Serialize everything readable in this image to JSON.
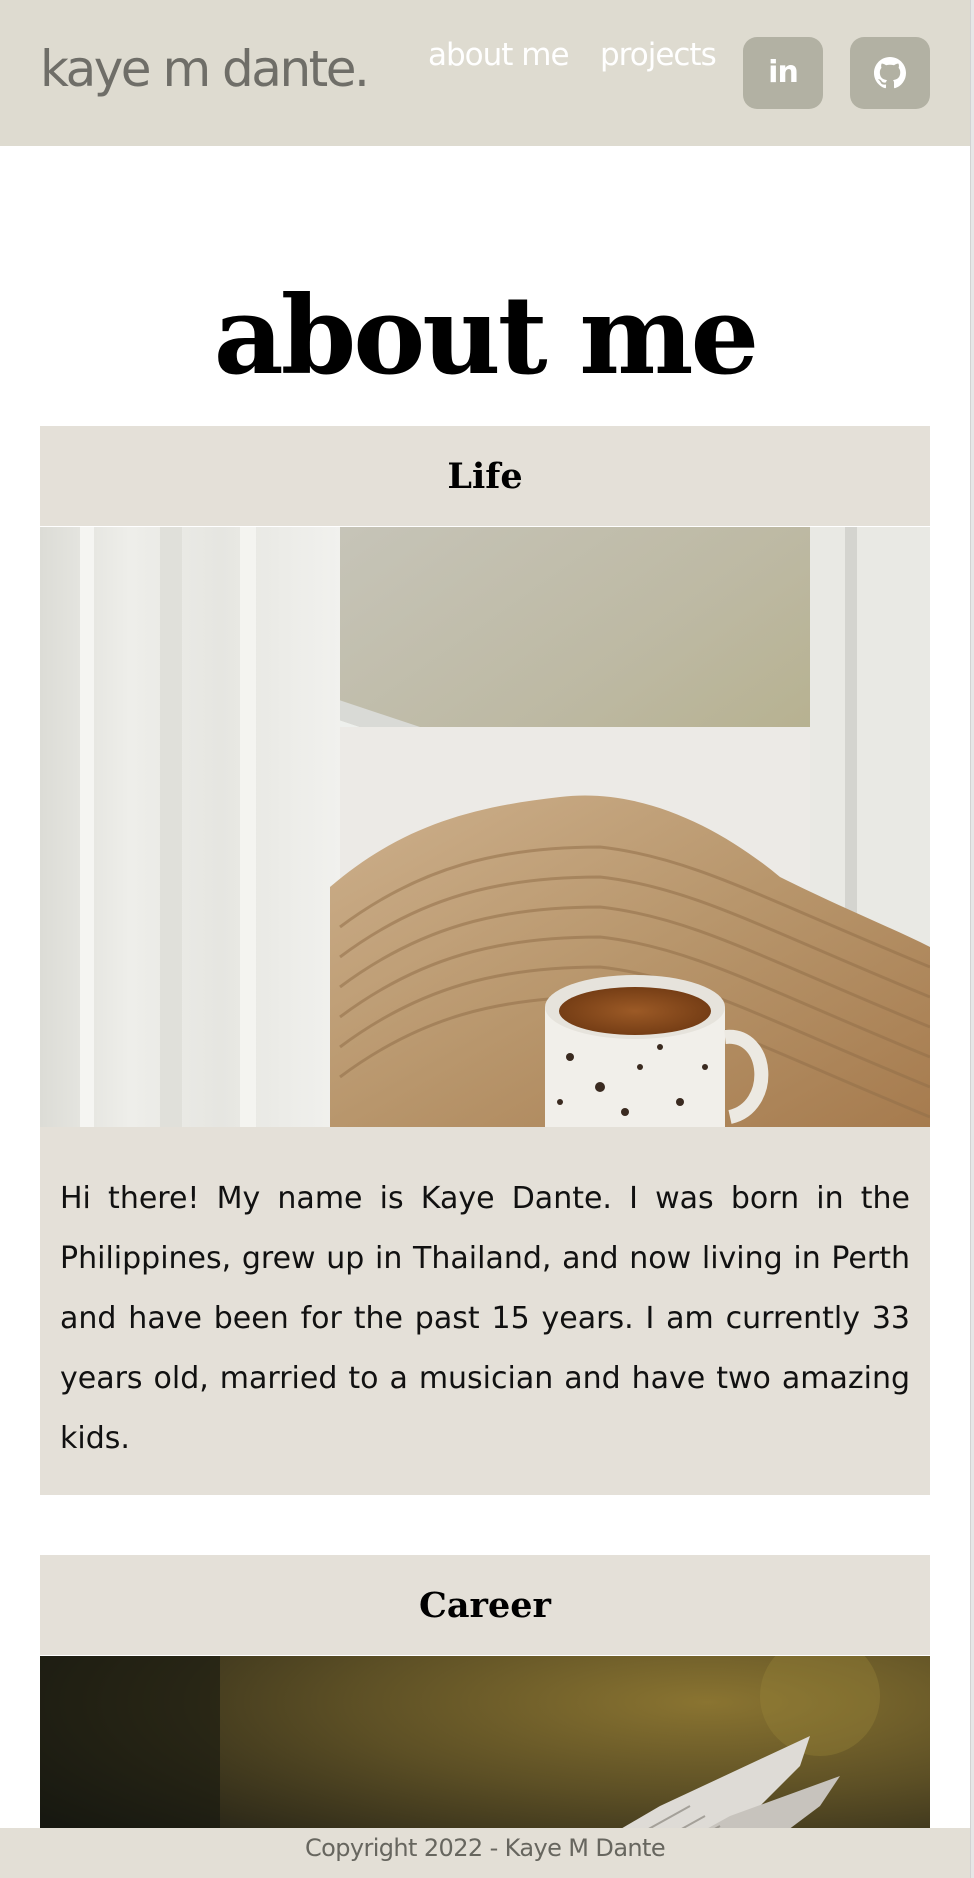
{
  "header": {
    "brand": "kaye m dante.",
    "nav": {
      "about": "about me",
      "projects": "projects"
    },
    "social": {
      "linkedin_glyph": "in",
      "linkedin_icon": "linkedin-icon",
      "github_icon": "github-icon"
    }
  },
  "main": {
    "title": "about me",
    "sections": [
      {
        "heading": "Life",
        "image": "cozy-window-tea-photo",
        "body": "Hi there! My name is Kaye Dante. I was born in the Philippines, grew up in Thailand, and now living in Perth and have been for the past 15 years. I am currently 33 years old, married to a musician and have two amazing kids."
      },
      {
        "heading": "Career",
        "image": "career-notebook-photo"
      }
    ]
  },
  "footer": {
    "copyright": "Copyright 2022 - Kaye M Dante"
  },
  "colors": {
    "header_bg": "#dedbd0",
    "panel_bg": "#e4e0d8",
    "button_bg": "#b2b1a3",
    "brand_text": "#6f6e68",
    "nav_text": "#ffffff"
  }
}
